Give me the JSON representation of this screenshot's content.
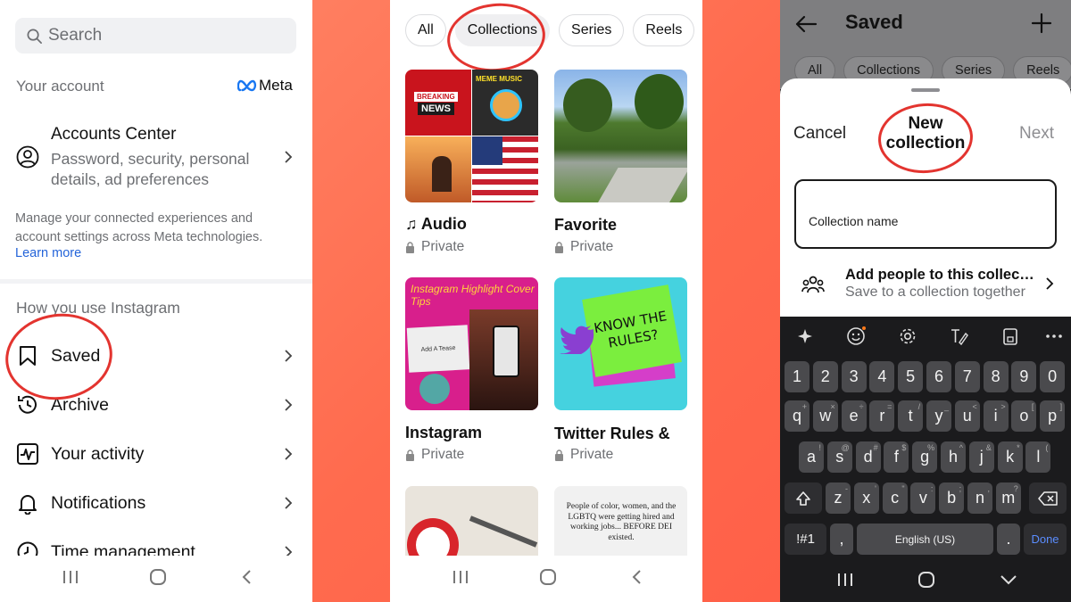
{
  "panel1": {
    "search_placeholder": "Search",
    "your_account": "Your account",
    "meta_label": "Meta",
    "accounts_center": {
      "title": "Accounts Center",
      "subtitle": "Password, security, personal details, ad preferences"
    },
    "manage_text": "Manage your connected experiences and account settings across Meta technologies.",
    "learn_more": "Learn more",
    "section_title": "How you use Instagram",
    "menu": [
      {
        "label": "Saved",
        "icon": "bookmark-icon"
      },
      {
        "label": "Archive",
        "icon": "archive-icon"
      },
      {
        "label": "Your activity",
        "icon": "activity-icon"
      },
      {
        "label": "Notifications",
        "icon": "bell-icon"
      },
      {
        "label": "Time management",
        "icon": "clock-icon"
      }
    ]
  },
  "panel2": {
    "chips": [
      "All",
      "Collections",
      "Series",
      "Reels"
    ],
    "active_chip": "Collections",
    "collections": [
      {
        "name": "♫ Audio",
        "privacy": "Private"
      },
      {
        "name": "Favorite",
        "privacy": "Private"
      },
      {
        "name": "Instagram",
        "privacy": "Private"
      },
      {
        "name": "Twitter Rules &",
        "privacy": "Private"
      }
    ],
    "thumb_text": {
      "breaking": "BREAKING",
      "news": "NEWS",
      "meme_music": "MEME MUSIC",
      "highlight": "Instagram Highlight Cover Tips",
      "add_tease": "Add A Tease",
      "know_rules": "KNOW THE RULES?",
      "dei_text": "People of color, women, and the LGBTQ were getting hired and working jobs... BEFORE DEI existed."
    }
  },
  "panel3": {
    "title": "Saved",
    "chips": [
      "All",
      "Collections",
      "Series",
      "Reels"
    ],
    "cancel": "Cancel",
    "sheet_title": "New collection",
    "next": "Next",
    "name_placeholder": "Collection name",
    "add_people_title": "Add people to this collection",
    "add_people_sub": "Save to a collection together",
    "keyboard": {
      "numbers": [
        "1",
        "2",
        "3",
        "4",
        "5",
        "6",
        "7",
        "8",
        "9",
        "0"
      ],
      "row1": [
        "q",
        "w",
        "e",
        "r",
        "t",
        "y",
        "u",
        "i",
        "o",
        "p"
      ],
      "row1_alt": [
        "+",
        "×",
        "÷",
        "=",
        "/",
        "_",
        "<",
        ">",
        "[",
        "]"
      ],
      "row2": [
        "a",
        "s",
        "d",
        "f",
        "g",
        "h",
        "j",
        "k",
        "l"
      ],
      "row2_alt": [
        "!",
        "@",
        "#",
        "$",
        "%",
        "^",
        "&",
        "*",
        "("
      ],
      "row3": [
        "z",
        "x",
        "c",
        "v",
        "b",
        "n",
        "m"
      ],
      "row3_alt": [
        "-",
        "'",
        "\"",
        ":",
        ";",
        ",",
        "?"
      ],
      "symbols": "!#1",
      "comma": ",",
      "space_label": "English (US)",
      "period": ".",
      "done": "Done"
    }
  },
  "colors": {
    "background": "#ff6b4e",
    "annotation_red": "#e3342f",
    "link_blue": "#2464d9",
    "keyboard_dark": "#1b1b1d"
  }
}
